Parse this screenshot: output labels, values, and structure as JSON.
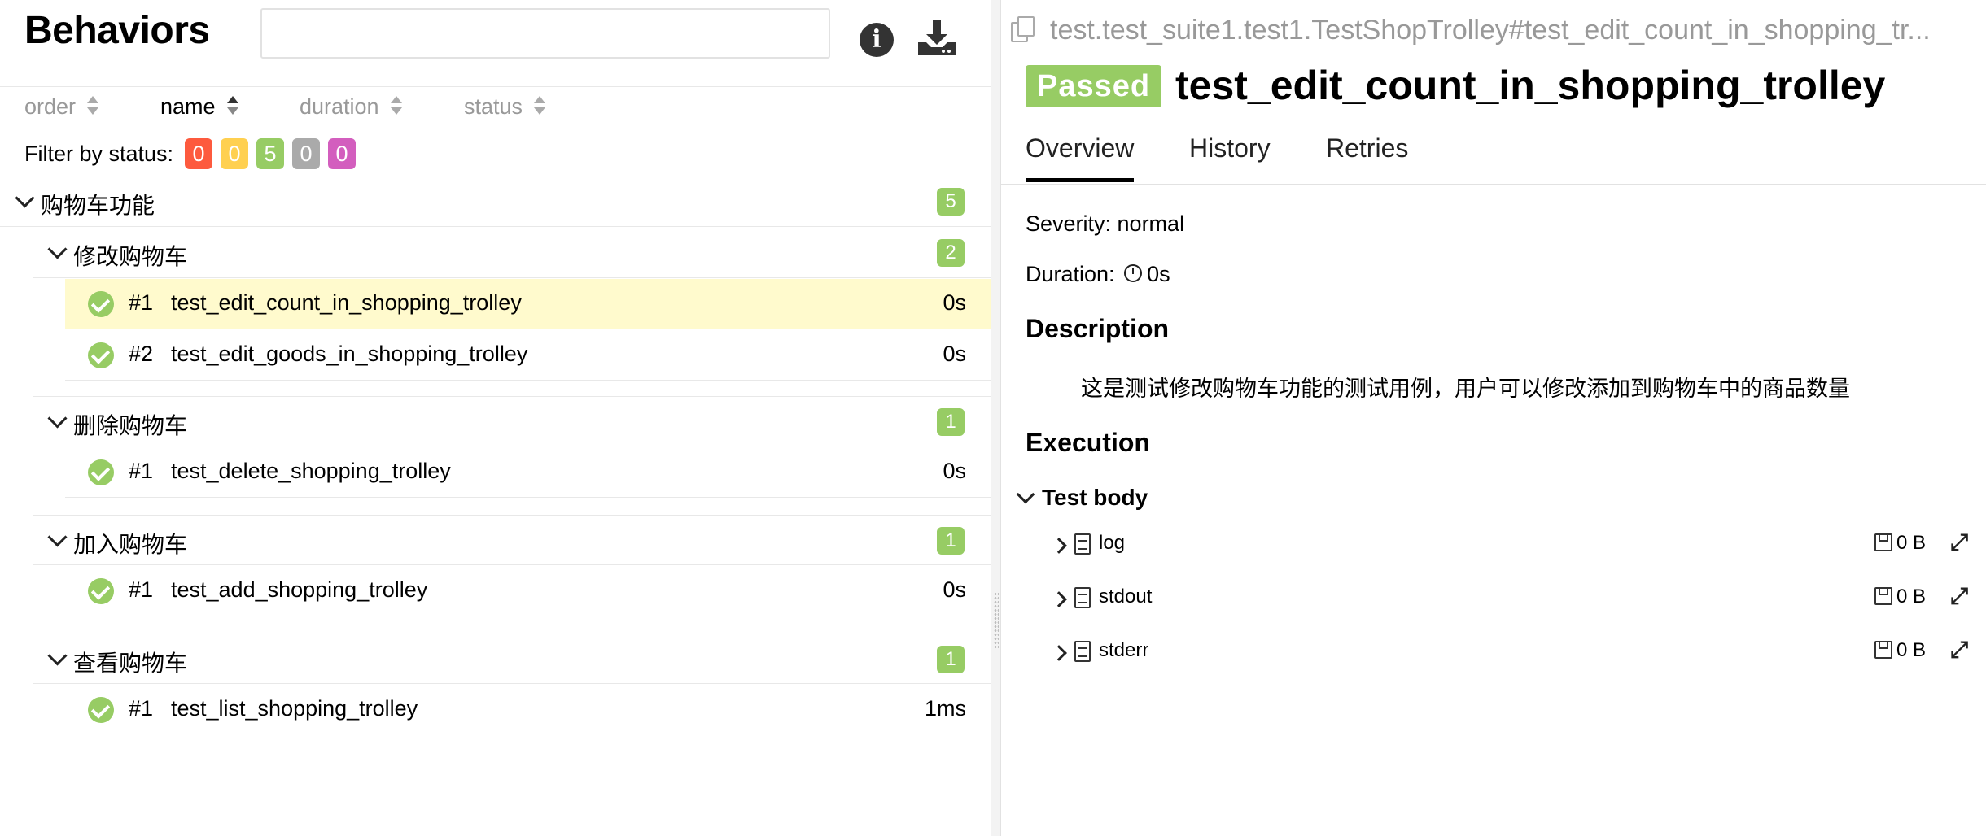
{
  "left": {
    "title": "Behaviors",
    "search": {
      "value": "",
      "placeholder": ""
    },
    "sort": [
      {
        "label": "order",
        "active": false
      },
      {
        "label": "name",
        "active": true
      },
      {
        "label": "duration",
        "active": false
      },
      {
        "label": "status",
        "active": false
      }
    ],
    "filter": {
      "label": "Filter by status:",
      "badges": [
        {
          "value": "0",
          "color": "#fd5a3e"
        },
        {
          "value": "0",
          "color": "#ffd050"
        },
        {
          "value": "5",
          "color": "#97cc64"
        },
        {
          "value": "0",
          "color": "#aaaaaa"
        },
        {
          "value": "0",
          "color": "#d35ebe"
        }
      ]
    },
    "tree": {
      "root": {
        "name": "购物车功能",
        "count": "5"
      },
      "groups": [
        {
          "name": "修改购物车",
          "count": "2",
          "tests": [
            {
              "num": "#1",
              "name": "test_edit_count_in_shopping_trolley",
              "duration": "0s",
              "selected": true
            },
            {
              "num": "#2",
              "name": "test_edit_goods_in_shopping_trolley",
              "duration": "0s",
              "selected": false
            }
          ]
        },
        {
          "name": "删除购物车",
          "count": "1",
          "tests": [
            {
              "num": "#1",
              "name": "test_delete_shopping_trolley",
              "duration": "0s",
              "selected": false
            }
          ]
        },
        {
          "name": "加入购物车",
          "count": "1",
          "tests": [
            {
              "num": "#1",
              "name": "test_add_shopping_trolley",
              "duration": "0s",
              "selected": false
            }
          ]
        },
        {
          "name": "查看购物车",
          "count": "1",
          "tests": [
            {
              "num": "#1",
              "name": "test_list_shopping_trolley",
              "duration": "1ms",
              "selected": false
            }
          ]
        }
      ]
    }
  },
  "right": {
    "breadcrumb": "test.test_suite1.test1.TestShopTrolley#test_edit_count_in_shopping_tr...",
    "status": "Passed",
    "status_color": "#97cc64",
    "title": "test_edit_count_in_shopping_trolley",
    "tabs": [
      "Overview",
      "History",
      "Retries"
    ],
    "severity": "Severity: normal",
    "duration_label": "Duration:",
    "duration_value": "0s",
    "description_heading": "Description",
    "description": "这是测试修改购物车功能的测试用例，用户可以修改添加到购物车中的商品数量",
    "execution_heading": "Execution",
    "test_body_label": "Test body",
    "attachments": [
      {
        "name": "log",
        "size": "0 B"
      },
      {
        "name": "stdout",
        "size": "0 B"
      },
      {
        "name": "stderr",
        "size": "0 B"
      }
    ]
  }
}
